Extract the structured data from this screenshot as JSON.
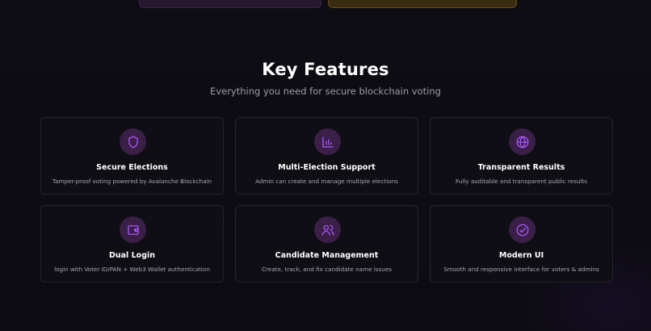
{
  "section": {
    "title": "Key Features",
    "subtitle": "Everything you need for secure blockchain voting"
  },
  "features": [
    {
      "icon": "shield-icon",
      "title": "Secure Elections",
      "description": "Tamper-proof voting powered by Avalanche Blockchain"
    },
    {
      "icon": "bar-chart-icon",
      "title": "Multi-Election Support",
      "description": "Admin can create and manage multiple elections"
    },
    {
      "icon": "globe-icon",
      "title": "Transparent Results",
      "description": "Fully auditable and transparent public results"
    },
    {
      "icon": "wallet-icon",
      "title": "Dual Login",
      "description": "login with Voter ID/PAN + Web3 Wallet authentication"
    },
    {
      "icon": "users-icon",
      "title": "Candidate Management",
      "description": "Create, track, and fix candidate name issues"
    },
    {
      "icon": "check-circle-icon",
      "title": "Modern UI",
      "description": "Smooth and responsive interface for voters & admins"
    }
  ],
  "colors": {
    "background": "#0d0c13",
    "card_border": "#24222b",
    "icon_bg": "#3a1f46",
    "icon_stroke": "#a855f7",
    "subtitle_text": "#9d9aa8"
  }
}
